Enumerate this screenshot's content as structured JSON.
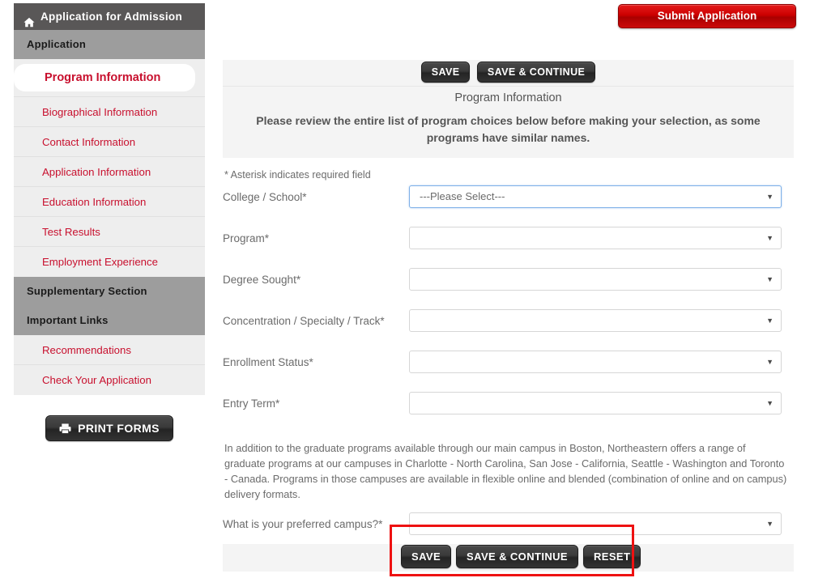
{
  "sidebar": {
    "header": {
      "title": "Application for Admission",
      "icon": "home-icon"
    },
    "section_application": "Application",
    "nav_items": [
      {
        "label": "Program Information",
        "active": true
      },
      {
        "label": "Biographical Information",
        "active": false
      },
      {
        "label": "Contact Information",
        "active": false
      },
      {
        "label": "Application Information",
        "active": false
      },
      {
        "label": "Education Information",
        "active": false
      },
      {
        "label": "Test Results",
        "active": false
      },
      {
        "label": "Employment Experience",
        "active": false
      }
    ],
    "section_supplementary": "Supplementary Section",
    "section_important_links": "Important Links",
    "links": [
      {
        "label": "Recommendations"
      },
      {
        "label": "Check Your Application"
      }
    ],
    "print_forms_label": "PRINT FORMS",
    "print_icon": "printer-icon"
  },
  "header": {
    "submit_label": "Submit Application"
  },
  "toolbar_top": {
    "save_label": "SAVE",
    "save_continue_label": "SAVE & CONTINUE"
  },
  "panel": {
    "title": "Program Information",
    "notice": "Please review the entire list of program choices below before making your selection, as some programs have similar names.",
    "asterisk_note": "* Asterisk indicates required field"
  },
  "form": {
    "fields": [
      {
        "label": "College / School*",
        "value": "---Please Select---",
        "focused": true
      },
      {
        "label": "Program*",
        "value": "",
        "focused": false
      },
      {
        "label": "Degree Sought*",
        "value": "",
        "focused": false
      },
      {
        "label": "Concentration / Specialty / Track*",
        "value": "",
        "focused": false
      },
      {
        "label": "Enrollment Status*",
        "value": "",
        "focused": false
      },
      {
        "label": "Entry Term*",
        "value": "",
        "focused": false
      }
    ],
    "campus_note": "In addition to the graduate programs available through our main campus in Boston, Northeastern offers a range of graduate programs at our campuses in Charlotte - North Carolina, San Jose - California, Seattle - Washington and Toronto - Canada. Programs in those campuses are available in flexible online and blended (combination of online and on campus) delivery formats.",
    "campus_field": {
      "label": "What is your preferred campus?*",
      "value": ""
    }
  },
  "toolbar_bottom": {
    "save_label": "SAVE",
    "save_continue_label": "SAVE & CONTINUE",
    "reset_label": "RESET"
  },
  "colors": {
    "accent_red": "#c8102e",
    "submit_red": "#cc0000",
    "highlight_red": "#ee1111",
    "sidebar_header": "#595757",
    "section_bar": "#9d9d9d",
    "panel_bg": "#f4f4f4",
    "focus_blue": "#7eb0e8"
  }
}
